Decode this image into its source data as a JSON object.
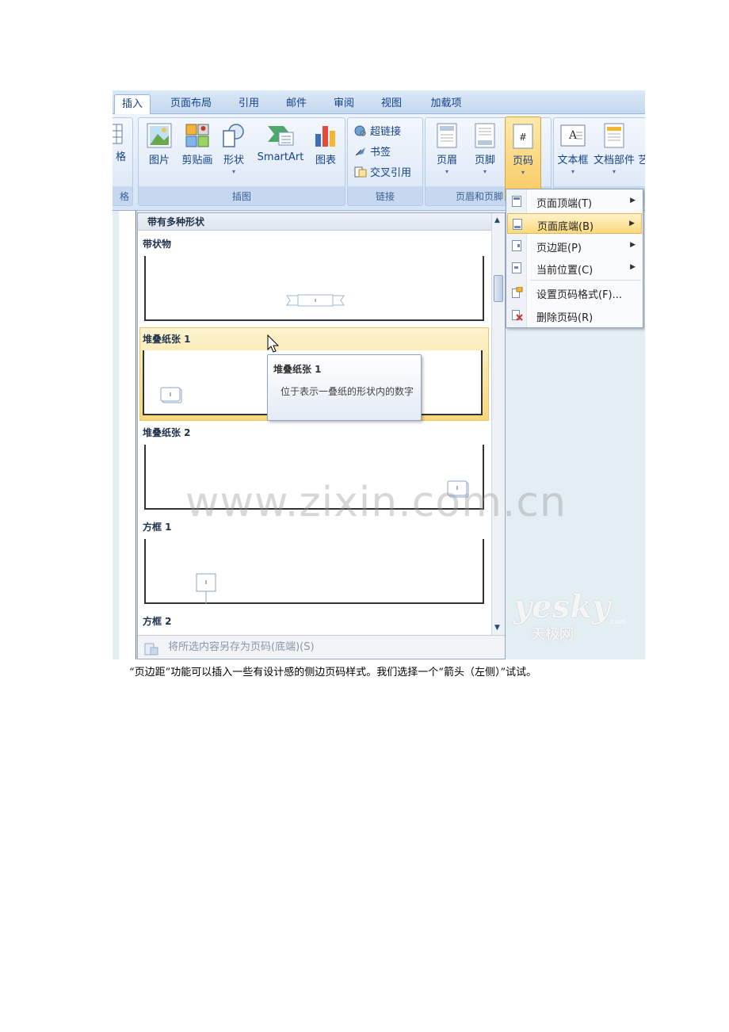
{
  "tabs": [
    "插入",
    "页面布局",
    "引用",
    "邮件",
    "审阅",
    "视图",
    "加载项"
  ],
  "active_tab": "插入",
  "ribbon": {
    "partial_left_label": "格",
    "partial_left_group": "格",
    "illustrations": {
      "buttons": [
        "图片",
        "剪贴画",
        "形状",
        "SmartArt",
        "图表"
      ],
      "group_label": "插图"
    },
    "links": {
      "items": [
        "超链接",
        "书签",
        "交叉引用"
      ],
      "group_label": "链接"
    },
    "header_footer": {
      "buttons": [
        "页眉",
        "页脚",
        "页码"
      ],
      "group_label": "页眉和页脚"
    },
    "text": {
      "buttons": [
        "文本框",
        "文档部件",
        "艺"
      ]
    }
  },
  "gallery": {
    "header": "带有多种形状",
    "sections": [
      {
        "title": "带状物"
      },
      {
        "title": "堆叠纸张 1"
      },
      {
        "title": "堆叠纸张 2"
      },
      {
        "title": "方框 1"
      },
      {
        "title": "方框 2"
      }
    ],
    "footer": "将所选内容另存为页码(底端)(S)"
  },
  "tooltip": {
    "title": "堆叠纸张 1",
    "body": "位于表示一叠纸的形状内的数字"
  },
  "menu": {
    "items": [
      {
        "label": "页面顶端(T)",
        "submenu": true
      },
      {
        "label": "页面底端(B)",
        "submenu": true
      },
      {
        "label": "页边距(P)",
        "submenu": true
      },
      {
        "label": "当前位置(C)",
        "submenu": true
      },
      {
        "label": "设置页码格式(F)...",
        "submenu": false
      },
      {
        "label": "删除页码(R)",
        "submenu": false
      }
    ],
    "highlighted": "页面底端(B)"
  },
  "watermark": "www.zixin.com.cn",
  "logo": {
    "brand": "yesky",
    "cn": "天极网",
    "suffix": ".com"
  },
  "caption": "“页边距”功能可以插入一些有设计感的侧边页码样式。我们选择一个“箭头（左侧）”试试。",
  "colors": {
    "accent": "#15428b",
    "highlight": "#fbd97d",
    "ribbon": "#dfeaf8"
  }
}
